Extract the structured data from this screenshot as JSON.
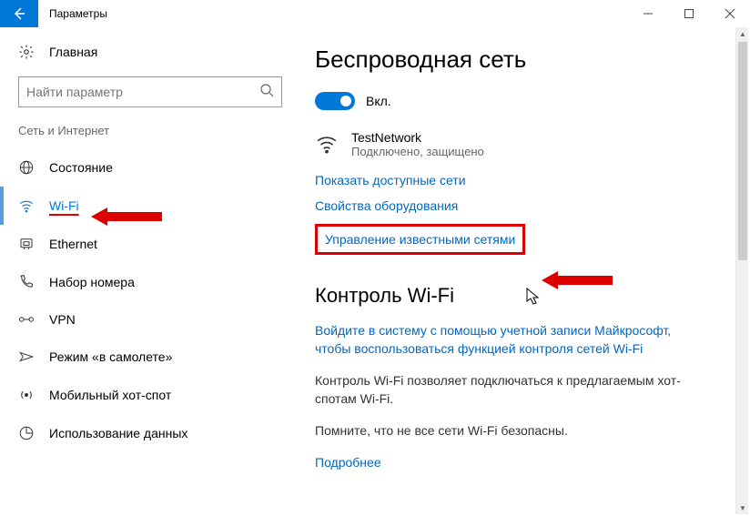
{
  "titlebar": {
    "title": "Параметры"
  },
  "sidebar": {
    "home": "Главная",
    "search_placeholder": "Найти параметр",
    "section": "Сеть и Интернет",
    "items": [
      {
        "label": "Состояние"
      },
      {
        "label": "Wi-Fi"
      },
      {
        "label": "Ethernet"
      },
      {
        "label": "Набор номера"
      },
      {
        "label": "VPN"
      },
      {
        "label": "Режим «в самолете»"
      },
      {
        "label": "Мобильный хот-спот"
      },
      {
        "label": "Использование данных"
      }
    ]
  },
  "main": {
    "heading": "Беспроводная сеть",
    "toggle_label": "Вкл.",
    "network": {
      "name": "TestNetwork",
      "status": "Подключено, защищено"
    },
    "link_show_networks": "Показать доступные сети",
    "link_hw_props": "Свойства оборудования",
    "link_manage_known": "Управление известными сетями",
    "heading2": "Контроль Wi-Fi",
    "signin_link": "Войдите в систему с помощью учетной записи Майкрософт, чтобы воспользоваться функцией контроля сетей Wi-Fi",
    "para1": "Контроль Wi-Fi позволяет подключаться к предлагаемым хот-спотам Wi-Fi.",
    "para2": "Помните, что не все сети Wi-Fi безопасны.",
    "more": "Подробнее"
  }
}
